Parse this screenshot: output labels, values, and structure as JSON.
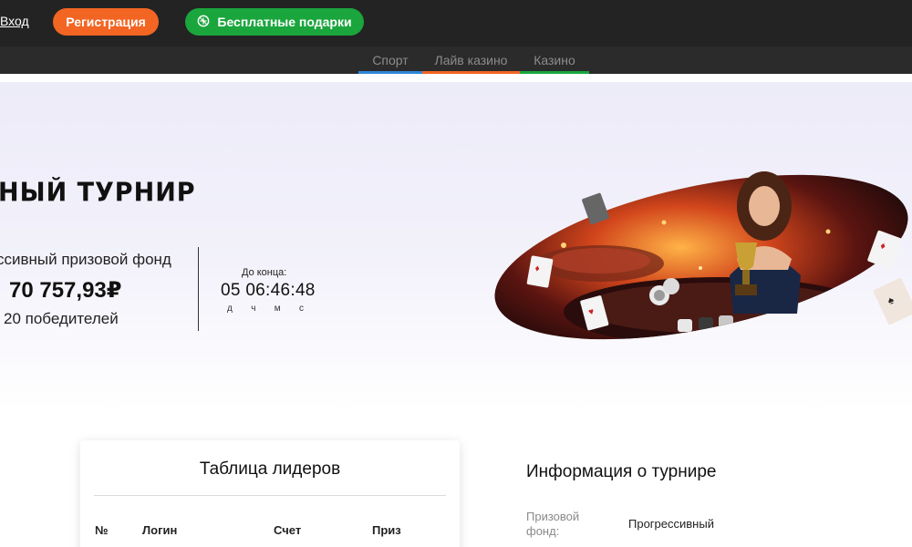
{
  "header": {
    "login_label": "Вход",
    "register_label": "Регистрация",
    "gifts_label": "Бесплатные подарки"
  },
  "nav": {
    "tabs": [
      {
        "label": "Спорт",
        "color": "#2f86d6"
      },
      {
        "label": "Лайв казино",
        "color": "#f26522"
      },
      {
        "label": "Казино",
        "color": "#1aa53d"
      }
    ]
  },
  "hero": {
    "title": "НЫЙ ТУРНИР",
    "fund_label": "ссивный призовой фонд",
    "fund_amount": "70 757,93₽",
    "winners": "20 победителей",
    "until_end_label": "До конца:",
    "timer": "05 06:46:48",
    "timer_units": [
      "д",
      "ч",
      "м",
      "с"
    ]
  },
  "leaderboard": {
    "title": "Таблица лидеров",
    "columns": [
      "№",
      "Логин",
      "Счет",
      "Приз"
    ]
  },
  "info": {
    "title": "Информация о турнире",
    "rows": [
      {
        "key": "Призовой фонд:",
        "value": "Прогрессивный"
      }
    ]
  },
  "colors": {
    "topbar": "#232323",
    "register": "#f26522",
    "gifts": "#1aa53d"
  }
}
